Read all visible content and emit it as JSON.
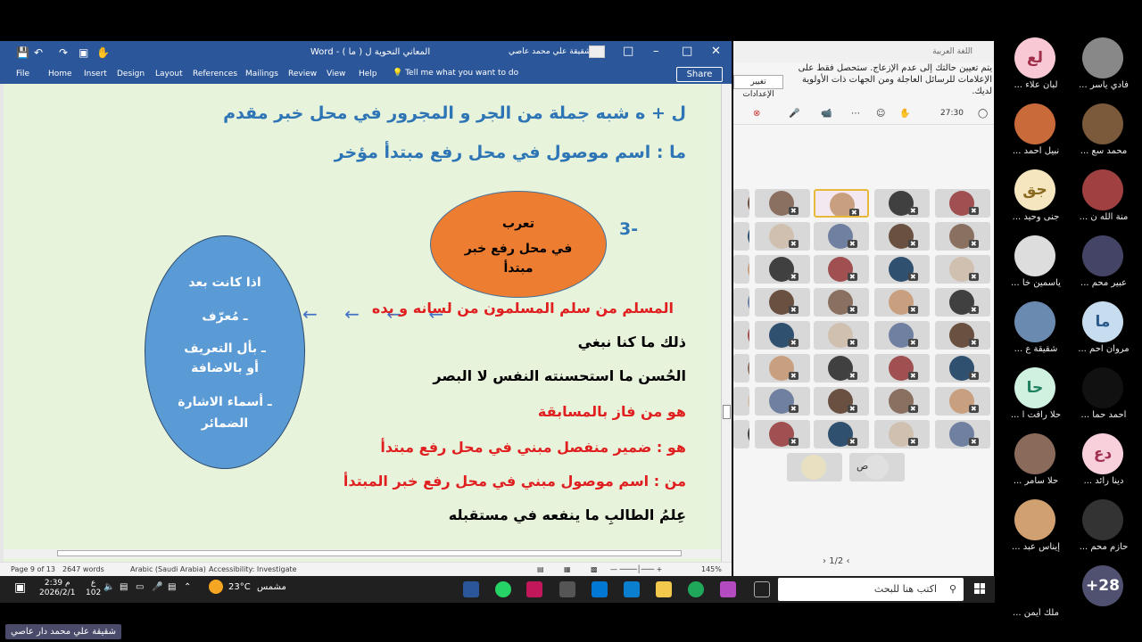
{
  "word": {
    "title": "المعاني النحوية ل ( ما ) - Word",
    "user": "شقيقة علي محمد عاصي",
    "tabs": [
      "File",
      "Home",
      "Insert",
      "Design",
      "Layout",
      "References",
      "Mailings",
      "Review",
      "View",
      "Help"
    ],
    "tell_me": "Tell me what you want to do",
    "share": "Share",
    "lines": {
      "l1": "ل + ه شبه جملة من الجر و المجرور  في محل خبر مقدم",
      "l2": "ما : اسم موصول في محل رفع مبتدأ مؤخر",
      "num": "-3",
      "orange1": "تعرب",
      "orange2": "في محل رفع خبر",
      "orange3": "مبتدأ",
      "blue1": "اذا كانت بعد",
      "blue2": "ـ مُعرّف",
      "blue3": "ـ بأل التعريف",
      "blue4": "أو بالاضافة",
      "blue5": "ـ أسماء الاشارة",
      "blue6": "الضمائر",
      "arrows": "← ← ← ←",
      "ex1": "المسلم من سلم المسلمون من لسانه و يده",
      "ex2": "ذلك ما كنا نبغي",
      "ex3": "الحُسن ما استحسنته النفس لا البصر",
      "ex4": "هو من فاز بالمسابقة",
      "ex5": "هو : ضمير منفصل مبني في محل رفع مبتدأ",
      "ex6": "من : اسم موصول مبني في محل رفع خبر المبتدأ",
      "ex7": "عِلمُ الطالبِ ما ينفعه في مستقبله"
    },
    "status": {
      "page": "Page 9 of 13",
      "words": "2647 words",
      "lang": "Arabic (Saudi Arabia)",
      "access": "Accessibility: Investigate",
      "zoom": "145%"
    }
  },
  "taskbar": {
    "time": "2:39 م",
    "date": "2026/2/1",
    "weather_temp": "23°C",
    "weather_desc": "مشمس",
    "search_placeholder": "اكتب هنا للبحث",
    "notif": "ع",
    "count": "102"
  },
  "teams": {
    "lang": "اللغة العربية",
    "notice": "يتم تعيين حالتك إلى عدم الإزعاج. ستحصل فقط على الإعلامات للرسائل العاجلة ومن الجهات ذات الأولوية لديك.",
    "notice_btn": "تغيير الإعدادات",
    "timer": "27:30",
    "pager": "1/2",
    "tile_label": "ص"
  },
  "presenter": "شقيقة علي محمد دار عاصي",
  "gallery": [
    {
      "initials": "لع",
      "name": "لبان علاء ...",
      "color": "#f8c8d4",
      "fg": "#a0304a"
    },
    {
      "initials": "",
      "name": "فادي ياسر ...",
      "color": "#888",
      "fg": "#fff"
    },
    {
      "initials": "",
      "name": "نبيل أحمد ...",
      "color": "#c86a3a",
      "fg": "#fff"
    },
    {
      "initials": "",
      "name": "محمد سع ...",
      "color": "#7a5a3a",
      "fg": "#fff"
    },
    {
      "initials": "جق",
      "name": "جنى وحيد ...",
      "color": "#f5e6c0",
      "fg": "#8a6a20"
    },
    {
      "initials": "",
      "name": "منة الله ن ...",
      "color": "#a04040",
      "fg": "#fff"
    },
    {
      "initials": "",
      "name": "ياسمين خا ...",
      "color": "#ddd",
      "fg": "#333"
    },
    {
      "initials": "",
      "name": "عبير محم ...",
      "color": "#446",
      "fg": "#fff"
    },
    {
      "initials": "",
      "name": "شقيقة ع ...",
      "color": "#6a8ab0",
      "fg": "#fff"
    },
    {
      "initials": "ما",
      "name": "مروان احم ...",
      "color": "#c8dcf0",
      "fg": "#2a5a8a"
    },
    {
      "initials": "حا",
      "name": "حلا رافت ا ...",
      "color": "#d0f0e0",
      "fg": "#208060"
    },
    {
      "initials": "",
      "name": "أحمد حما ...",
      "color": "#111",
      "fg": "#fff"
    },
    {
      "initials": "",
      "name": "حلا سامر ...",
      "color": "#8a6a5a",
      "fg": "#fff"
    },
    {
      "initials": "دع",
      "name": "دينا رائد ...",
      "color": "#f8d0dc",
      "fg": "#a03050"
    },
    {
      "initials": "",
      "name": "إيناس عبد ...",
      "color": "#d0a070",
      "fg": "#fff"
    },
    {
      "initials": "",
      "name": "حازم محم ...",
      "color": "#333",
      "fg": "#fff"
    },
    {
      "initials": "",
      "name": "ملك أيمن ...",
      "color": "#000",
      "fg": "#fff"
    },
    {
      "initials": "+28",
      "name": "",
      "color": "#505070",
      "fg": "#fff"
    }
  ]
}
